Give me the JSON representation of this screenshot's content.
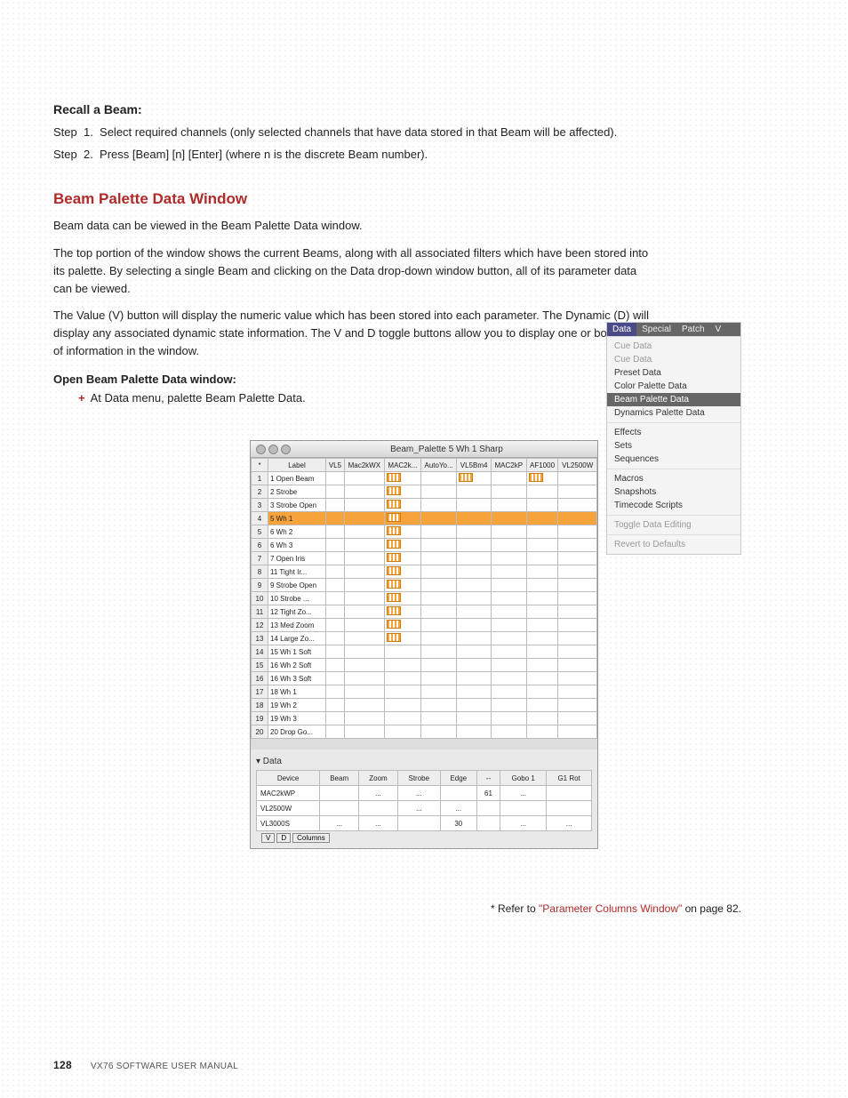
{
  "recall": {
    "heading": "Recall a Beam:",
    "step1": "Step  1.  Select required channels (only selected channels that have data stored in that Beam will be affected).",
    "step2": "Step  2.  Press [Beam] [n] [Enter] (where n is the discrete Beam number)."
  },
  "section": {
    "title": "Beam Palette Data Window",
    "p1": "Beam data can be viewed in the Beam Palette Data window.",
    "p2": "The top portion of the window shows the current Beams, along with all associated filters which have been stored into its palette. By selecting a single Beam and clicking on the Data drop-down window button, all of its parameter data can be viewed.",
    "p3": "The Value (V) button will display the numeric value which has been stored into each parameter. The Dynamic (D) will display any associated dynamic state information. The V and D toggle buttons allow you to display one or both types of information in the window.",
    "openHdr": "Open Beam Palette Data window:",
    "openLine": "At Data menu, palette Beam Palette Data."
  },
  "menu": {
    "tabs": [
      "Data",
      "Special",
      "Patch",
      "V"
    ],
    "groups": [
      [
        "Cue Data",
        "Cue Data",
        "Preset Data",
        "Color Palette Data",
        "Beam Palette Data",
        "Dynamics Palette Data"
      ],
      [
        "Effects",
        "Sets",
        "Sequences"
      ],
      [
        "Macros",
        "Snapshots",
        "Timecode Scripts"
      ],
      [
        "Toggle Data Editing"
      ],
      [
        "Revert to Defaults"
      ]
    ],
    "selected": "Beam Palette Data",
    "dim": [
      "Cue Data",
      "Toggle Data Editing",
      "Revert to Defaults"
    ]
  },
  "appwin": {
    "title": "Beam_Palette 5 Wh 1 Sharp",
    "cols": [
      "*",
      "Label",
      "VL5",
      "Mac2kWX",
      "MAC2k...",
      "AutoYo...",
      "VL5Bm4",
      "MAC2kP",
      "AF1000",
      "VL2500W"
    ],
    "rows": [
      {
        "n": "1",
        "label": "1 Open Beam",
        "icons": [
          3
        ],
        "sel": false
      },
      {
        "n": "2",
        "label": "2 Strobe",
        "icons": [
          3
        ],
        "sel": false
      },
      {
        "n": "3",
        "label": "3 Strobe Open",
        "icons": [
          3
        ],
        "sel": false
      },
      {
        "n": "4",
        "label": "5 Wh 1",
        "icons": [
          3
        ],
        "sel": true
      },
      {
        "n": "5",
        "label": "6 Wh 2",
        "icons": [
          3
        ],
        "sel": false
      },
      {
        "n": "6",
        "label": "6 Wh 3",
        "icons": [
          3
        ],
        "sel": false
      },
      {
        "n": "7",
        "label": "7 Open Iris",
        "icons": [
          3
        ],
        "sel": false
      },
      {
        "n": "8",
        "label": "11 Tight Ir...",
        "icons": [
          3
        ],
        "sel": false
      },
      {
        "n": "9",
        "label": "9 Strobe Open",
        "icons": [
          3
        ],
        "sel": false
      },
      {
        "n": "10",
        "label": "10 Strobe ...",
        "icons": [
          3
        ],
        "sel": false
      },
      {
        "n": "11",
        "label": "12 Tight Zo...",
        "icons": [
          3
        ],
        "sel": false
      },
      {
        "n": "12",
        "label": "13 Med Zoom",
        "icons": [
          3
        ],
        "sel": false
      },
      {
        "n": "13",
        "label": "14 Large Zo...",
        "icons": [
          3
        ],
        "sel": false
      },
      {
        "n": "14",
        "label": "15 Wh 1 Soft",
        "icons": [],
        "sel": false
      },
      {
        "n": "15",
        "label": "16 Wh 2 Soft",
        "icons": [],
        "sel": false
      },
      {
        "n": "16",
        "label": "16 Wh 3 Soft",
        "icons": [],
        "sel": false
      },
      {
        "n": "17",
        "label": "18 Wh 1",
        "icons": [],
        "sel": false
      },
      {
        "n": "18",
        "label": "19 Wh 2",
        "icons": [],
        "sel": false
      },
      {
        "n": "19",
        "label": "19 Wh 3",
        "icons": [],
        "sel": false
      },
      {
        "n": "20",
        "label": "20 Drop Go...",
        "icons": [],
        "sel": false
      }
    ],
    "extraIcons": {
      "0": [
        5,
        7
      ]
    },
    "dataHdr": "▾ Data",
    "data2cols": [
      "Device",
      "Beam",
      "Zoom",
      "Strobe",
      "Edge",
      "--",
      "Gobo 1",
      "G1 Rot"
    ],
    "data2rows": [
      [
        "MAC2kWP",
        "",
        "...",
        "...",
        "",
        "61",
        "...",
        ""
      ],
      [
        "VL2500W",
        "",
        "",
        "...",
        "...",
        "",
        "",
        ""
      ],
      [
        "VL3000S",
        "...",
        "...",
        "",
        "30",
        "",
        "...",
        "..."
      ]
    ],
    "vd": [
      "V",
      "D",
      "Columns"
    ]
  },
  "footnote": {
    "pre": "* Refer to ",
    "link": "\"Parameter Columns Window\"",
    "post": " on page 82."
  },
  "footer": {
    "page": "128",
    "title": "VX76 SOFTWARE USER MANUAL"
  }
}
